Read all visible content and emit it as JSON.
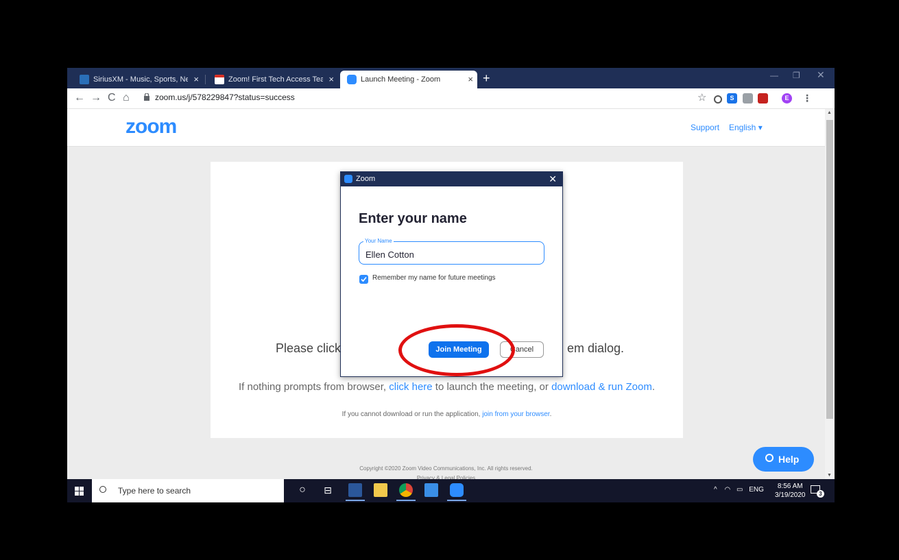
{
  "browser": {
    "tabs": [
      {
        "title": "SiriusXM - Music, Sports, News",
        "active": false
      },
      {
        "title": "Zoom! First Tech Access Team Meeting",
        "active": false
      },
      {
        "title": "Launch Meeting - Zoom",
        "active": true
      }
    ],
    "new_tab": "+",
    "url": "zoom.us/j/578229847?status=success",
    "profile_initial": "E"
  },
  "zoom_page": {
    "logo": "zoom",
    "support": "Support",
    "language": "English ▾",
    "prompt_left": "Please click",
    "prompt_right": "em dialog.",
    "fallback_prefix": "If nothing prompts from browser,",
    "fallback_link1": "click here",
    "fallback_middle": "to launch the meeting, or",
    "fallback_link2": "download & run Zoom",
    "fallback_suffix": ".",
    "browser_prefix": "If you cannot download or run the application,",
    "browser_link": "join from your browser",
    "browser_suffix": ".",
    "copyright": "Copyright ©2020 Zoom Video Communications, Inc. All rights reserved.",
    "privacy": "Privacy & Legal Policies",
    "help_button": "Help"
  },
  "dialog": {
    "title": "Zoom",
    "heading": "Enter your name",
    "name_label": "Your Name",
    "name_value": "Ellen Cotton",
    "remember_label": "Remember my name for future meetings",
    "remember_checked": true,
    "join_button": "Join Meeting",
    "cancel_button": "Cancel"
  },
  "taskbar": {
    "search_placeholder": "Type here to search",
    "tray_lang": "ENG",
    "time": "8:56 AM",
    "date": "3/19/2020",
    "notifications": "3"
  },
  "colors": {
    "zoom_blue": "#2d8cff",
    "join_blue": "#0e72ed",
    "titlebar_navy": "#1f2f56",
    "highlight_red": "#e01010"
  }
}
